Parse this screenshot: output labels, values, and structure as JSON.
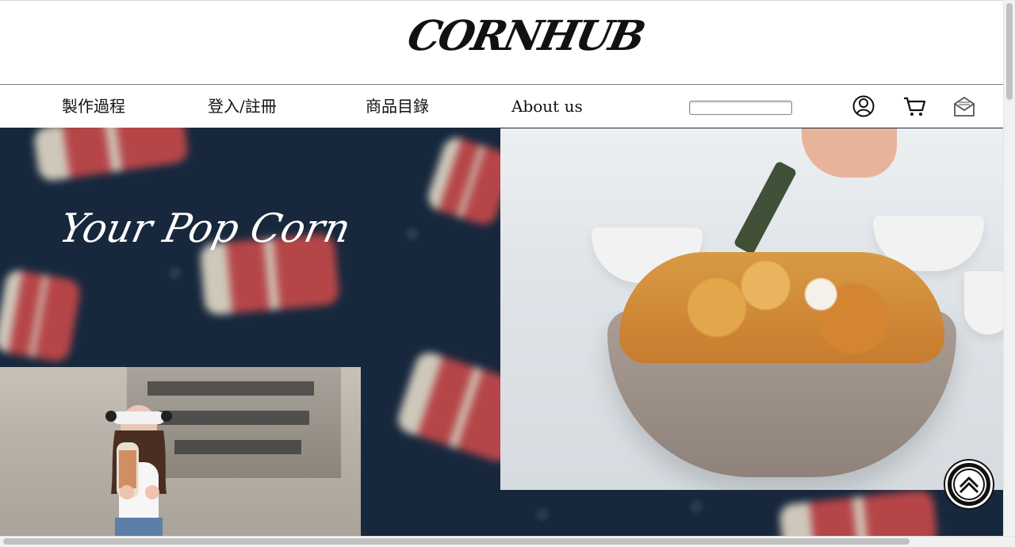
{
  "brand": {
    "logo_text": "CORNHUB"
  },
  "nav": {
    "items": [
      "製作過程",
      "登入/註冊",
      "商品目錄",
      "About us"
    ],
    "search_value": ""
  },
  "hero": {
    "tagline": "Your Pop Corn"
  },
  "icons": [
    "user-icon",
    "cart-icon",
    "mail-icon",
    "back-to-top-icon"
  ],
  "colors": {
    "hero_background": "#17283d",
    "header_background": "#ffffff"
  }
}
